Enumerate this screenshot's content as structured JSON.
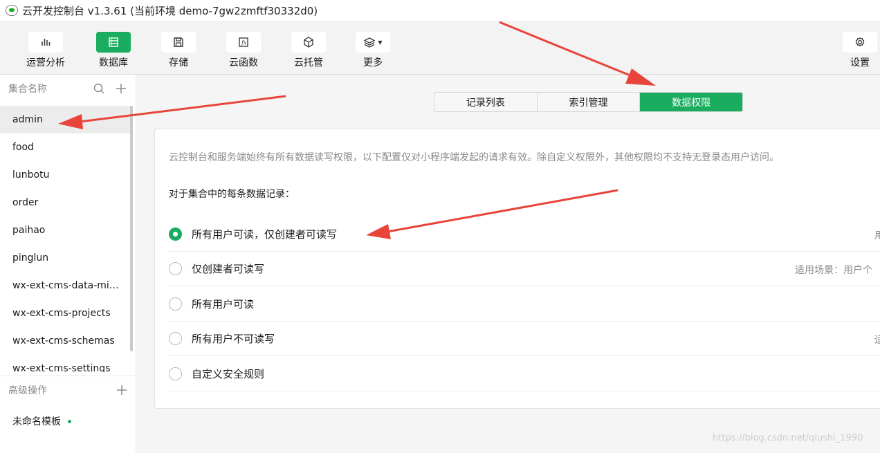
{
  "window": {
    "title": "云开发控制台 v1.3.61  (当前环境 demo-7gw2zmftf30332d0)"
  },
  "toolbar": {
    "items": [
      {
        "label": "运营分析",
        "icon": "bar-chart-icon"
      },
      {
        "label": "数据库",
        "icon": "database-icon"
      },
      {
        "label": "存储",
        "icon": "floppy-icon"
      },
      {
        "label": "云函数",
        "icon": "function-icon"
      },
      {
        "label": "云托管",
        "icon": "cube-icon"
      },
      {
        "label": "更多",
        "icon": "layers-icon"
      }
    ],
    "settings_label": "设置"
  },
  "sidebar": {
    "collections_title": "集合名称",
    "collections": [
      "admin",
      "food",
      "lunbotu",
      "order",
      "paihao",
      "pinglun",
      "wx-ext-cms-data-mig...",
      "wx-ext-cms-projects",
      "wx-ext-cms-schemas",
      "wx-ext-cms-settings"
    ],
    "advanced_title": "高级操作",
    "templates": [
      "未命名模板"
    ]
  },
  "tabs": [
    "记录列表",
    "索引管理",
    "数据权限"
  ],
  "permission": {
    "note": "云控制台和服务端始终有所有数据读写权限，以下配置仅对小程序端发起的请求有效。除自定义权限外，其他权限均不支持无登录态用户访问。",
    "subtitle": "对于集合中的每条数据记录：",
    "options": [
      {
        "label": "所有用户可读，仅创建者可读写",
        "hint": "用",
        "selected": true
      },
      {
        "label": "仅创建者可读写",
        "hint": "适用场景：用户个",
        "selected": false
      },
      {
        "label": "所有用户可读",
        "hint": "",
        "selected": false
      },
      {
        "label": "所有用户不可读写",
        "hint": "适",
        "selected": false
      },
      {
        "label": "自定义安全规则",
        "hint": "",
        "selected": false
      }
    ]
  },
  "watermark": "https://blog.csdn.net/qiushi_1990",
  "colors": {
    "accent": "#1aad5f",
    "arrow": "#e8443a"
  }
}
